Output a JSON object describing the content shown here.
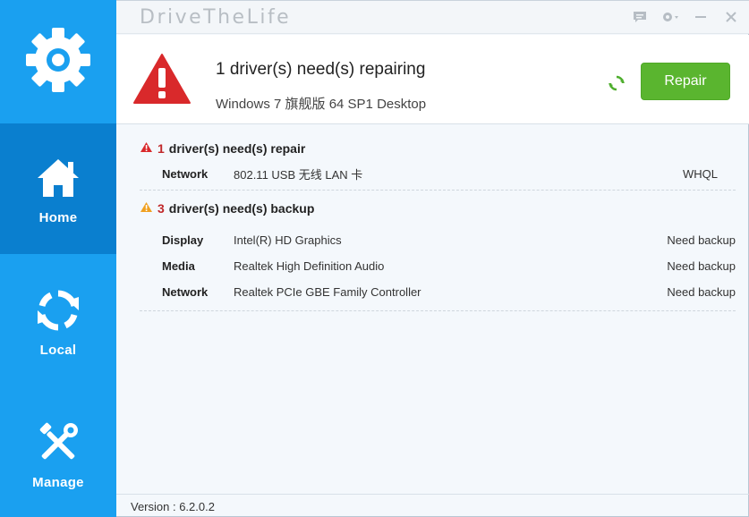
{
  "sidebar": {
    "logo_icon": "gear-icon",
    "items": [
      {
        "id": "home",
        "label": "Home",
        "icon": "house-icon",
        "active": true
      },
      {
        "id": "local",
        "label": "Local",
        "icon": "refresh-icon",
        "active": false
      },
      {
        "id": "manage",
        "label": "Manage",
        "icon": "tools-icon",
        "active": false
      }
    ]
  },
  "titlebar": {
    "title": "DriveTheLife",
    "controls": [
      "feedback-icon",
      "settings-icon",
      "minimize-icon",
      "close-icon"
    ]
  },
  "status": {
    "title": "1 driver(s) need(s) repairing",
    "os": "Windows 7 旗舰版  64 SP1 Desktop",
    "repair_label": "Repair"
  },
  "repair_section": {
    "count": "1",
    "heading": "driver(s) need(s) repair",
    "rows": [
      {
        "category": "Network",
        "device": "802.11 USB 无线 LAN 卡",
        "status": "WHQL"
      }
    ]
  },
  "backup_section": {
    "count": "3",
    "heading": "driver(s) need(s) backup",
    "rows": [
      {
        "category": "Display",
        "device": "Intel(R) HD Graphics",
        "status": "Need backup"
      },
      {
        "category": "Media",
        "device": "Realtek High Definition Audio",
        "status": "Need backup"
      },
      {
        "category": "Network",
        "device": "Realtek PCIe GBE Family Controller",
        "status": "Need backup"
      }
    ]
  },
  "footer": {
    "version": "Version : 6.2.0.2"
  },
  "colors": {
    "sidebar": "#1aa0f0",
    "sidebar_active": "#0a7fcf",
    "repair_button": "#5ab52f",
    "warning_red": "#d9292b",
    "warning_orange": "#f0a020"
  }
}
